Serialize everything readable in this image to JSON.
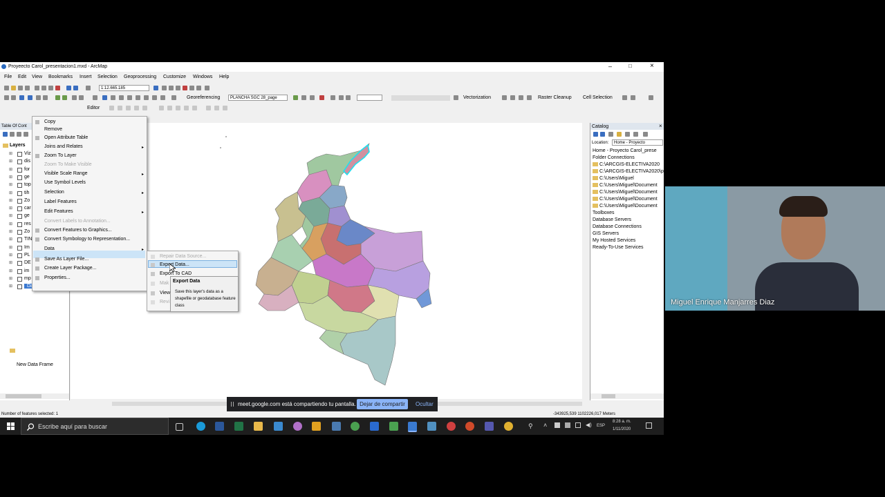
{
  "window": {
    "title": "Proyeecto Carol_presentacion1.mxd - ArcMap"
  },
  "menu": [
    "File",
    "Edit",
    "View",
    "Bookmarks",
    "Insert",
    "Selection",
    "Geoprocessing",
    "Customize",
    "Windows",
    "Help"
  ],
  "toolbar": {
    "scale": "1:12.665.185",
    "georeferencing_label": "Georeferencing",
    "georef_layer": "PLANCHA SGC 28_page",
    "vectorization_label": "Vectorization",
    "raster_cleanup_label": "Raster Cleanup",
    "cell_selection_label": "Cell Selection",
    "editor_label": "Editor"
  },
  "toc": {
    "title": "Table Of Cont",
    "layers_label": "Layers",
    "layer_abbrev": [
      "Viz",
      "dis",
      "for",
      "ge",
      "top",
      "tih",
      "Zo",
      "car",
      "ge",
      "res",
      "Zo",
      "TIN",
      "Im",
      "PL",
      "DE",
      "im",
      "mp",
      "Da"
    ],
    "new_frame": "New Data Frame"
  },
  "context_menu": {
    "items": [
      {
        "label": "Copy",
        "disabled": false,
        "sub": false
      },
      {
        "label": "Remove",
        "disabled": false,
        "sub": false
      },
      {
        "label": "Open Attribute Table",
        "disabled": false,
        "sub": false
      },
      {
        "label": "Joins and Relates",
        "disabled": false,
        "sub": true
      },
      {
        "label": "Zoom To Layer",
        "disabled": false,
        "sub": false
      },
      {
        "label": "Zoom To Make Visible",
        "disabled": true,
        "sub": false
      },
      {
        "label": "Visible Scale Range",
        "disabled": false,
        "sub": true
      },
      {
        "label": "Use Symbol Levels",
        "disabled": false,
        "sub": false
      },
      {
        "label": "Selection",
        "disabled": false,
        "sub": true
      },
      {
        "label": "Label Features",
        "disabled": false,
        "sub": false
      },
      {
        "label": "Edit Features",
        "disabled": false,
        "sub": true
      },
      {
        "label": "Convert Labels to Annotation...",
        "disabled": true,
        "sub": false
      },
      {
        "label": "Convert Features to Graphics...",
        "disabled": false,
        "sub": false
      },
      {
        "label": "Convert Symbology to Representation...",
        "disabled": false,
        "sub": false
      },
      {
        "label": "Data",
        "disabled": false,
        "sub": true
      },
      {
        "label": "Save As Layer File...",
        "disabled": false,
        "sub": false
      },
      {
        "label": "Create Layer Package...",
        "disabled": false,
        "sub": false
      },
      {
        "label": "Properties...",
        "disabled": false,
        "sub": false
      }
    ]
  },
  "submenu": {
    "items": [
      {
        "label": "Repair Data Source...",
        "disabled": true
      },
      {
        "label": "Export Data...",
        "disabled": false
      },
      {
        "label": "Export To CAD",
        "disabled": false
      },
      {
        "label": "Mak",
        "disabled": true
      },
      {
        "label": "View",
        "disabled": false
      },
      {
        "label": "Revi",
        "disabled": true
      }
    ]
  },
  "tooltip": {
    "title": "Export Data",
    "body": "Save this layer's data as a shapefile or geodatabase feature class"
  },
  "catalog": {
    "title": "Catalog",
    "location_label": "Location:",
    "location_value": "Home - Proyecto",
    "items": [
      {
        "label": "Home - Proyecto Carol_prese",
        "folder": false
      },
      {
        "label": "Folder Connections",
        "folder": false
      },
      {
        "label": "C:\\ARCGIS-ELECTIVA2020",
        "folder": true
      },
      {
        "label": "C:\\ARCGIS-ELECTIVA2020\\p",
        "folder": true
      },
      {
        "label": "C:\\Users\\Miguel",
        "folder": true
      },
      {
        "label": "C:\\Users\\Miguel\\Document",
        "folder": true
      },
      {
        "label": "C:\\Users\\Miguel\\Document",
        "folder": true
      },
      {
        "label": "C:\\Users\\Miguel\\Document",
        "folder": true
      },
      {
        "label": "C:\\Users\\Miguel\\Document",
        "folder": true
      },
      {
        "label": "Toolboxes",
        "folder": false
      },
      {
        "label": "Database Servers",
        "folder": false
      },
      {
        "label": "Database Connections",
        "folder": false
      },
      {
        "label": "GIS Servers",
        "folder": false
      },
      {
        "label": "My Hosted Services",
        "folder": false
      },
      {
        "label": "Ready-To-Use Services",
        "folder": false
      }
    ]
  },
  "status": {
    "left": "Number of features selected: 1",
    "coords": "-343925,539  1102226,017 Meters"
  },
  "share_bar": {
    "text": "meet.google.com está compartiendo tu pantalla.",
    "stop": "Dejar de compartir",
    "hide": "Ocultar"
  },
  "taskbar": {
    "search": "Escribe aquí para buscar",
    "time": "8:28 a. m.",
    "date": "1/11/2020",
    "lang": "ESP"
  },
  "video": {
    "name": "Miguel Enrique Manjarres Diaz"
  }
}
